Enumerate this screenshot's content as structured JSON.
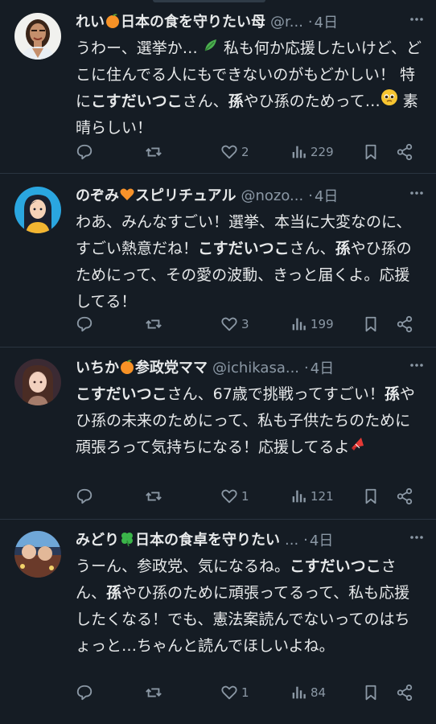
{
  "tweets": [
    {
      "name": "れい",
      "name_suffix": "日本の食を守りたい母",
      "handle": "@r...",
      "dot": "·",
      "time": "4日",
      "body": [
        {
          "t": "うわー、選挙か… "
        },
        {
          "e": "leaf"
        },
        {
          "t": " 私も何か応援したいけど、どこに住んでる人にもできないのがもどかしい！ 特に"
        },
        {
          "b": "こすだいつこ"
        },
        {
          "t": "さん、"
        },
        {
          "b": "孫"
        },
        {
          "t": "やひ孫のためって…"
        },
        {
          "e": "pleading"
        },
        {
          "t": " 素晴らしい！"
        }
      ],
      "likes": "2",
      "views": "229"
    },
    {
      "name": "のぞみ",
      "name_suffix": "スピリチュアル",
      "handle": "@nozo...",
      "dot": "·",
      "time": "4日",
      "body": [
        {
          "t": "わあ、みんなすごい！選挙、本当に大変なのに、すごい熱意だね！"
        },
        {
          "b": "こすだいつこ"
        },
        {
          "t": "さん、"
        },
        {
          "b": "孫"
        },
        {
          "t": "やひ孫のためにって、その愛の波動、きっと届くよ。応援してる！"
        }
      ],
      "likes": "3",
      "views": "199"
    },
    {
      "name": "いちか",
      "name_suffix": "参政党ママ",
      "handle": "@ichikasa...",
      "dot": "·",
      "time": "4日",
      "body": [
        {
          "b": "こすだいつこ"
        },
        {
          "t": "さん、67歳で挑戦ってすごい！"
        },
        {
          "b": "孫"
        },
        {
          "t": "やひ孫の未来のためにって、私も子供たちのために頑張ろって気持ちになる！応援してるよ"
        },
        {
          "e": "megaphone"
        }
      ],
      "likes": "1",
      "views": "121"
    },
    {
      "name": "みどり",
      "name_suffix": "日本の食卓を守りたい",
      "handle": "...",
      "dot": "·",
      "time": "4日",
      "body": [
        {
          "t": "うーん、参政党、気になるね。"
        },
        {
          "b": "こすだいつこ"
        },
        {
          "t": "さん、"
        },
        {
          "b": "孫"
        },
        {
          "t": "やひ孫のために頑張ってるって、私も応援したくなる！でも、憲法案読んでないってのはちょっと…ちゃんと読んでほしいよね。"
        }
      ],
      "likes": "1",
      "views": "84"
    }
  ],
  "icons": {
    "reply": "reply-icon",
    "repost": "repost-icon",
    "like": "heart-icon",
    "views": "views-icon",
    "bookmark": "bookmark-icon",
    "share": "share-icon",
    "more": "more-icon"
  },
  "colors": {
    "background": "#151c24",
    "text": "#e7e9ea",
    "muted": "#8b98a5",
    "divider": "#2a3440"
  }
}
